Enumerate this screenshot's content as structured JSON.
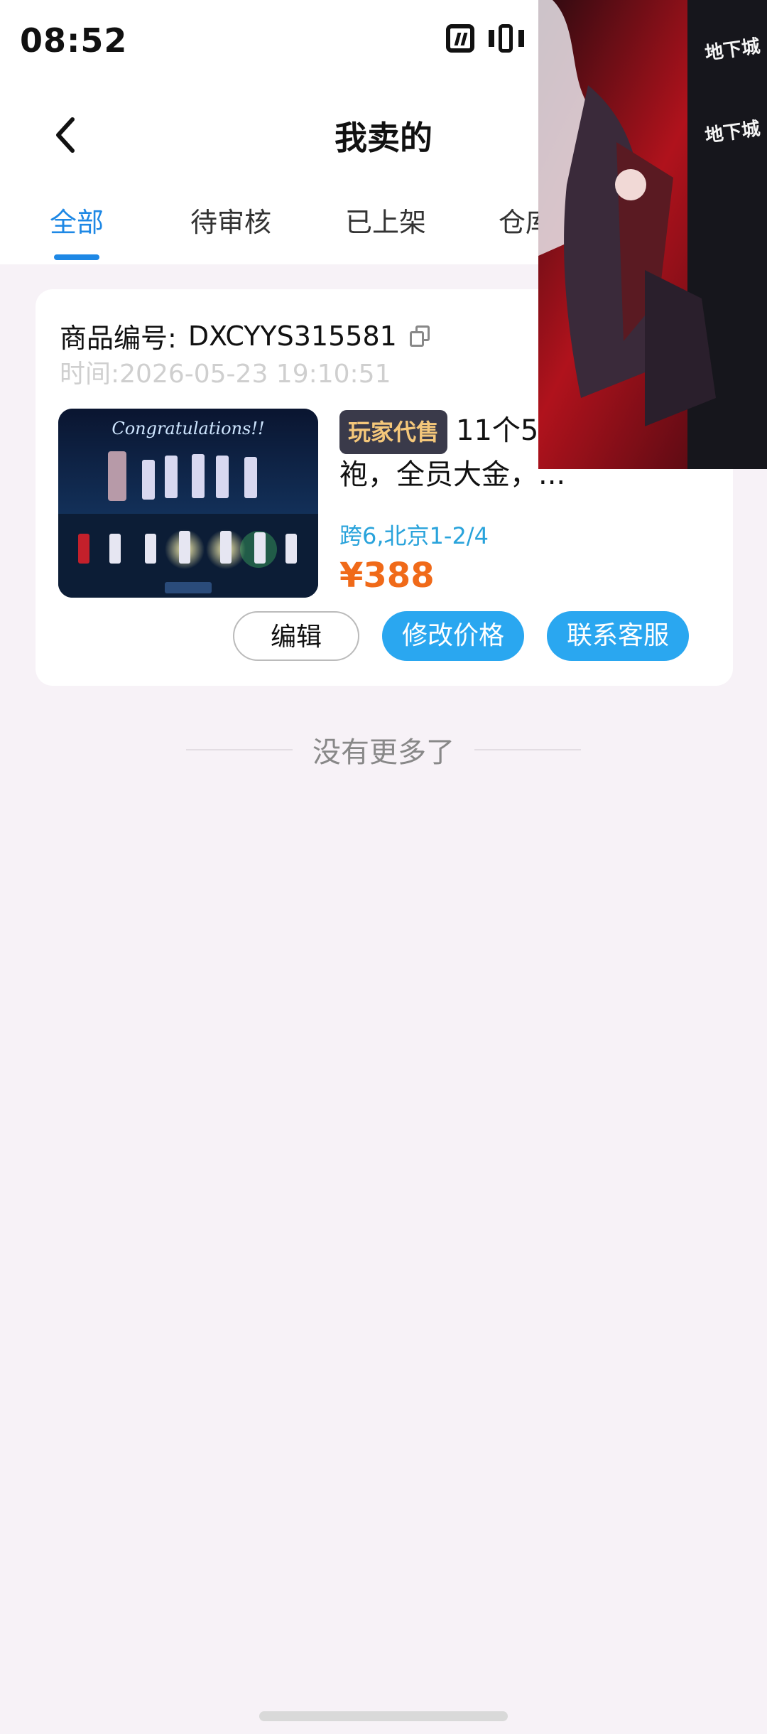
{
  "status_bar": {
    "time": "08:52"
  },
  "header": {
    "title": "我卖的"
  },
  "tabs": [
    {
      "label": "全部",
      "active": true
    },
    {
      "label": "待审核",
      "active": false
    },
    {
      "label": "已上架",
      "active": false
    },
    {
      "label": "仓库",
      "active": false
    }
  ],
  "order": {
    "id_label": "商品编号:",
    "id_value": "DXCYYS315581",
    "time": "时间:2026-05-23 19:10:51",
    "badge": "玩家代售",
    "title": "11个5... 央，2龙袍，全员大金，...",
    "server": "跨6,北京1-2/4",
    "price": "¥388",
    "thumb_caption": "Congratulations!!",
    "buttons": {
      "edit": "编辑",
      "change_price": "修改价格",
      "contact_service": "联系客服"
    }
  },
  "footer": {
    "no_more": "没有更多了"
  },
  "colors": {
    "accent": "#1e88e5",
    "price": "#f06a19",
    "server": "#29a3db",
    "button": "#2aa7f0"
  }
}
